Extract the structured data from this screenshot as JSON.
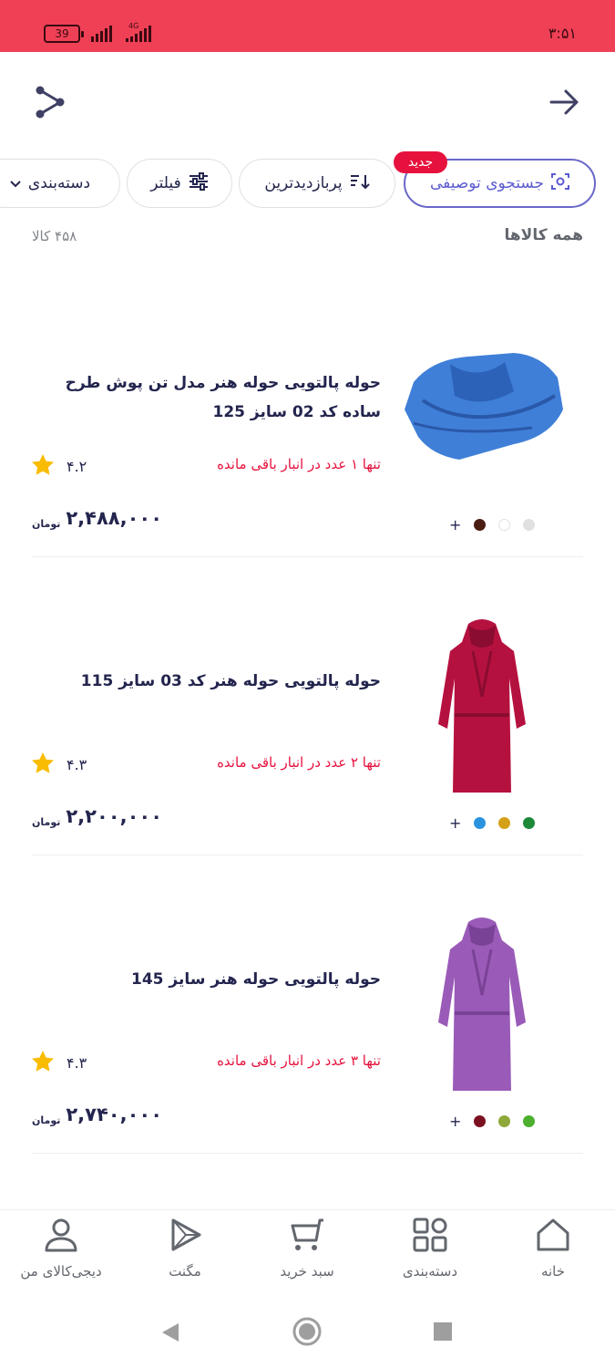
{
  "status_bar": {
    "battery": "39",
    "network": "4G",
    "time": "۳:۵۱",
    "background_color": "#ef4056"
  },
  "toolbar": {
    "back_icon": "arrow-right-icon",
    "share_icon": "share-icon"
  },
  "chips": {
    "visual_search": "جستجوی توصیفی",
    "new_badge": "جدید",
    "sort": "پربازدیدترین",
    "filter": "فیلتر",
    "category": "دسته‌بندی"
  },
  "section": {
    "title": "همه کالاها",
    "count": "۴۵۸ کالا"
  },
  "products": [
    {
      "title": "حوله پالتویی حوله هنر مدل تن پوش طرح ساده کد 02 سایز 125",
      "stock": "تنها ۱ عدد در انبار باقی مانده",
      "rating": "۴.۲",
      "price": "۲,۴۸۸,۰۰۰",
      "currency": "تومان",
      "swatches": [
        "#e0e0e0",
        "#ffffff",
        "#4a1c12"
      ],
      "image_color": "#3f7fd8"
    },
    {
      "title": "حوله پالتویی حوله هنر کد 03 سایز 115",
      "stock": "تنها ۲ عدد در انبار باقی مانده",
      "rating": "۴.۳",
      "price": "۲,۲۰۰,۰۰۰",
      "currency": "تومان",
      "swatches": [
        "#1d8a3a",
        "#d4a017",
        "#2a93e0"
      ],
      "image_color": "#b5113f"
    },
    {
      "title": "حوله پالتویی حوله هنر سایز 145",
      "stock": "تنها ۳ عدد در انبار باقی مانده",
      "rating": "۴.۳",
      "price": "۲,۷۴۰,۰۰۰",
      "currency": "تومان",
      "swatches": [
        "#4caf2e",
        "#8fa83a",
        "#7a1020"
      ],
      "image_color": "#9a5bb8"
    }
  ],
  "bottom_nav": {
    "home": "خانه",
    "categories": "دسته‌بندی",
    "cart": "سبد خرید",
    "magnet": "مگنت",
    "profile": "دیجی‌کالای من"
  },
  "colors": {
    "accent": "#ef4056",
    "stock_red": "#e6123d",
    "visual_purple": "#5b5bd0",
    "star": "#f9bc00"
  }
}
